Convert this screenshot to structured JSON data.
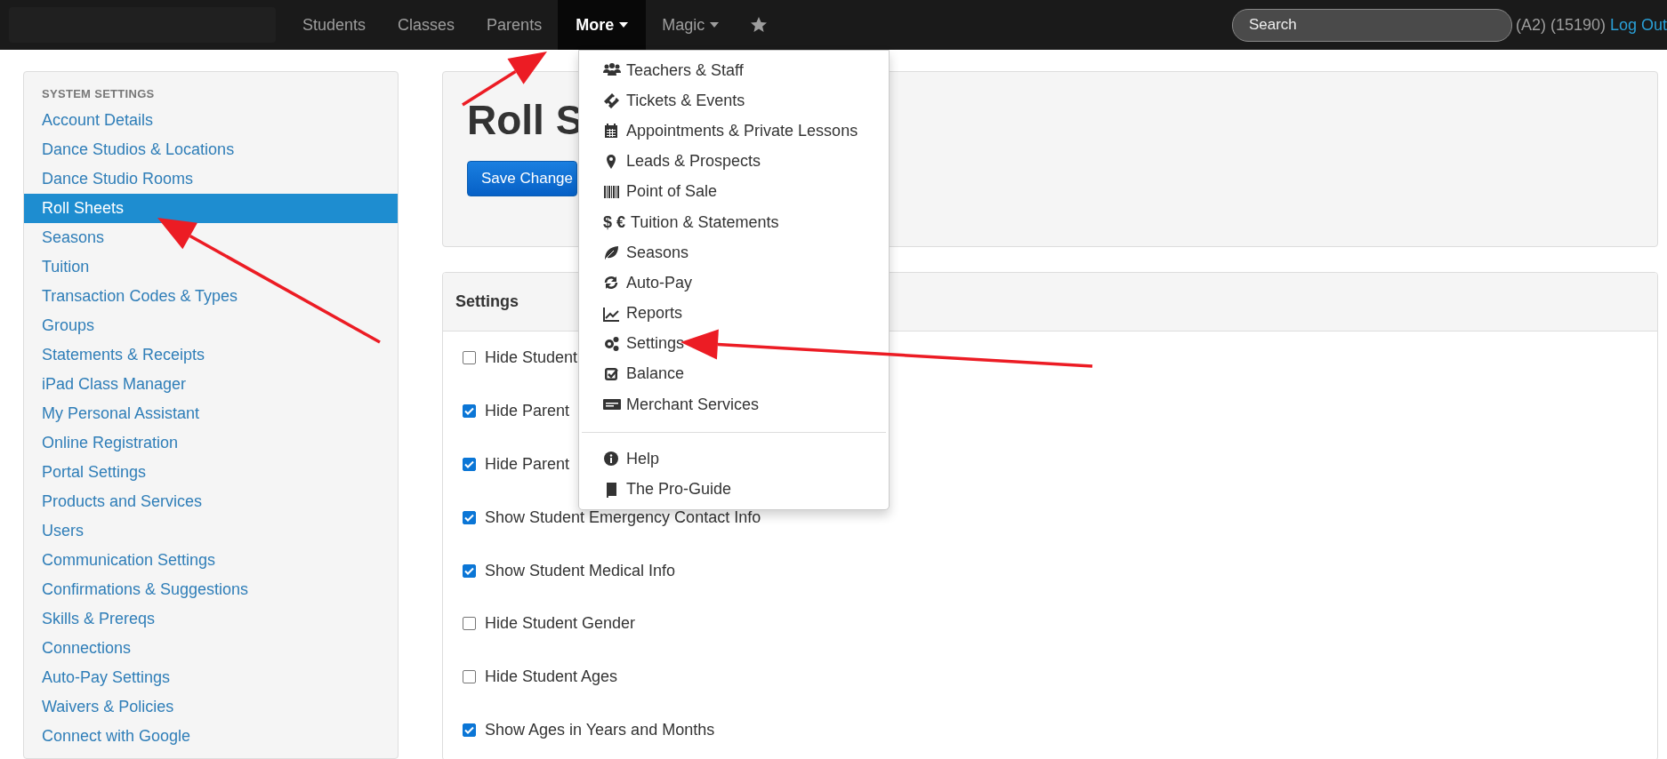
{
  "navbar": {
    "items": [
      {
        "kind": "link",
        "label": "Students",
        "selected": false,
        "dropdown": false
      },
      {
        "kind": "link",
        "label": "Classes",
        "selected": false,
        "dropdown": false
      },
      {
        "kind": "link",
        "label": "Parents",
        "selected": false,
        "dropdown": false
      },
      {
        "kind": "link",
        "label": "More",
        "selected": true,
        "dropdown": true
      },
      {
        "kind": "link",
        "label": "Magic",
        "selected": false,
        "dropdown": true
      },
      {
        "kind": "star",
        "selected": false
      }
    ],
    "search": {
      "placeholder": "Search"
    },
    "account": "(A2) (15190)",
    "logout": "Log Out"
  },
  "sidebar": {
    "heading": "SYSTEM SETTINGS",
    "items": [
      {
        "label": "Account Details",
        "selected": false
      },
      {
        "label": "Dance Studios & Locations",
        "selected": false
      },
      {
        "label": "Dance Studio Rooms",
        "selected": false
      },
      {
        "label": "Roll Sheets",
        "selected": true
      },
      {
        "label": "Seasons",
        "selected": false
      },
      {
        "label": "Tuition",
        "selected": false
      },
      {
        "label": "Transaction Codes & Types",
        "selected": false
      },
      {
        "label": "Groups",
        "selected": false
      },
      {
        "label": "Statements & Receipts",
        "selected": false
      },
      {
        "label": "iPad Class Manager",
        "selected": false
      },
      {
        "label": "My Personal Assistant",
        "selected": false
      },
      {
        "label": "Online Registration",
        "selected": false
      },
      {
        "label": "Portal Settings",
        "selected": false
      },
      {
        "label": "Products and Services",
        "selected": false
      },
      {
        "label": "Users",
        "selected": false
      },
      {
        "label": "Communication Settings",
        "selected": false
      },
      {
        "label": "Confirmations & Suggestions",
        "selected": false
      },
      {
        "label": "Skills & Prereqs",
        "selected": false
      },
      {
        "label": "Connections",
        "selected": false
      },
      {
        "label": "Auto-Pay Settings",
        "selected": false
      },
      {
        "label": "Waivers & Policies",
        "selected": false
      },
      {
        "label": "Connect with Google",
        "selected": false
      }
    ]
  },
  "page": {
    "title": "Roll S",
    "save_button": "Save Change"
  },
  "settings": {
    "heading": "Settings",
    "options": [
      {
        "label": "Hide Student",
        "checked": false
      },
      {
        "label": "Hide Parent",
        "checked": true
      },
      {
        "label": "Hide Parent",
        "checked": true
      },
      {
        "label": "Show Student Emergency Contact Info",
        "checked": true
      },
      {
        "label": "Show Student Medical Info",
        "checked": true
      },
      {
        "label": "Hide Student Gender",
        "checked": false
      },
      {
        "label": "Hide Student Ages",
        "checked": false
      },
      {
        "label": "Show Ages in Years and Months",
        "checked": true
      }
    ]
  },
  "menu": {
    "items": [
      {
        "kind": "item",
        "label": "Teachers & Staff"
      },
      {
        "kind": "item",
        "label": "Tickets & Events"
      },
      {
        "kind": "item",
        "label": "Appointments & Private Lessons"
      },
      {
        "kind": "item",
        "label": "Leads & Prospects"
      },
      {
        "kind": "item",
        "label": "Point of Sale"
      },
      {
        "kind": "item",
        "label": "Tuition & Statements",
        "symbol": "$ €"
      },
      {
        "kind": "item",
        "label": "Seasons"
      },
      {
        "kind": "item",
        "label": "Auto-Pay"
      },
      {
        "kind": "item",
        "label": "Reports"
      },
      {
        "kind": "item",
        "label": "Settings"
      },
      {
        "kind": "item",
        "label": "Balance"
      },
      {
        "kind": "item",
        "label": "Merchant Services"
      },
      {
        "kind": "divider"
      },
      {
        "kind": "item",
        "label": "Help"
      },
      {
        "kind": "item",
        "label": "The Pro-Guide"
      }
    ]
  },
  "annotations": [
    {
      "kind": "arrow"
    },
    {
      "kind": "arrow"
    },
    {
      "kind": "arrow"
    }
  ]
}
